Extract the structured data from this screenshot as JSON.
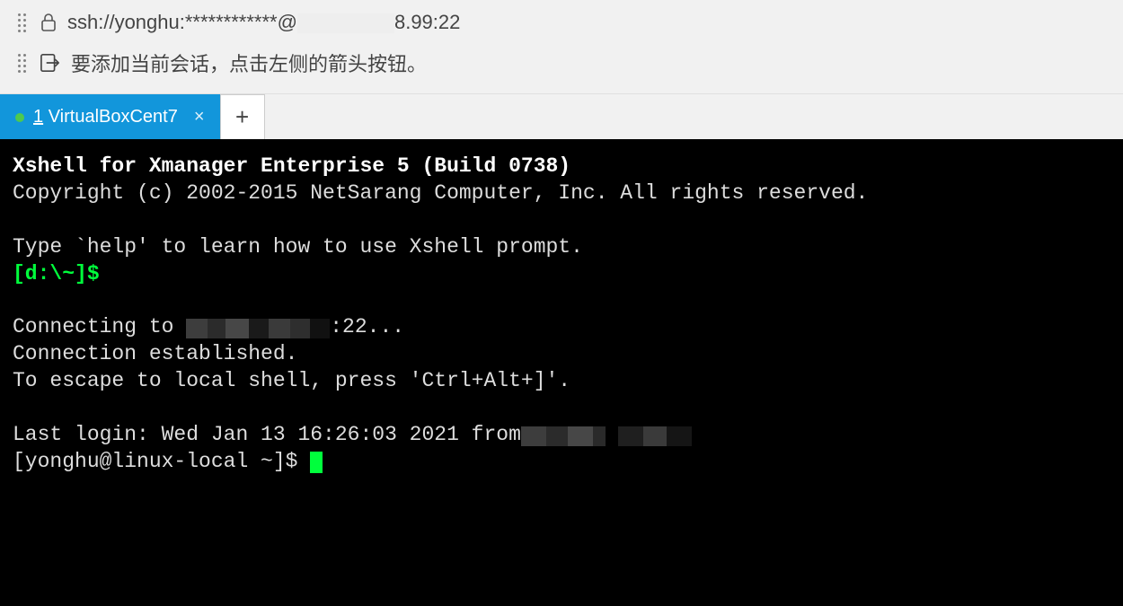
{
  "address": {
    "prefix": "ssh://yonghu:",
    "mask": "************",
    "at": "@",
    "ipsuffix": "8.99:22"
  },
  "hint_text": "要添加当前会话，点击左侧的箭头按钮。",
  "tab": {
    "num": "1",
    "label": "VirtualBoxCent7",
    "close": "×",
    "plus": "+"
  },
  "terminal": {
    "line1_bold": "Xshell for Xmanager Enterprise 5 (Build 0738)",
    "line2": "Copyright (c) 2002-2015 NetSarang Computer, Inc. All rights reserved.",
    "line3": "Type `help' to learn how to use Xshell prompt.",
    "local_prompt": "[d:\\~]$",
    "connecting_pre": "Connecting to ",
    "connecting_post": ":22...",
    "conn_est": "Connection established.",
    "escape": "To escape to local shell, press 'Ctrl+Alt+]'.",
    "last_login_pre": "Last login: Wed Jan 13 16:26:03 2021 from",
    "shell_prompt": "[yonghu@linux-local ~]$ "
  }
}
